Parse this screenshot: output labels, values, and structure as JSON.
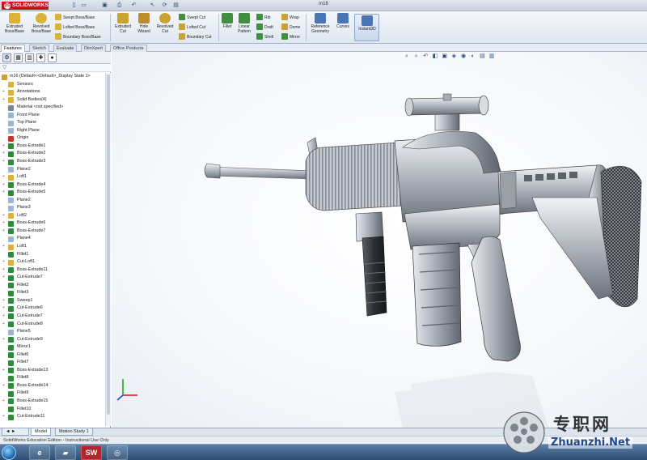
{
  "app": {
    "brand": "SOLIDWORKS",
    "doc_title": "m16",
    "quick_access": [
      "new-icon",
      "open-icon",
      "save-icon",
      "print-icon",
      "undo-icon",
      "select-icon",
      "rebuild-icon",
      "options-icon"
    ]
  },
  "command_manager": {
    "large_tools": [
      {
        "id": "extruded-boss",
        "label": "Extruded Boss/Base",
        "color": "#c9a234"
      },
      {
        "id": "revolved-boss",
        "label": "Revolved Boss/Base",
        "color": "#c9a234"
      },
      {
        "id": "extruded-cut",
        "label": "Extruded Cut",
        "color": "#c9a234"
      },
      {
        "id": "hole-wizard",
        "label": "Hole Wizard",
        "color": "#b88f2c"
      },
      {
        "id": "revolved-cut",
        "label": "Revolved Cut",
        "color": "#c9a234"
      },
      {
        "id": "fillet",
        "label": "Fillet",
        "color": "#3f8f3f"
      },
      {
        "id": "linear-pattern",
        "label": "Linear Pattern",
        "color": "#3f8f3f"
      },
      {
        "id": "reference-geometry",
        "label": "Reference Geometry",
        "color": "#4a74b5"
      },
      {
        "id": "curves",
        "label": "Curves",
        "color": "#4a74b5"
      },
      {
        "id": "instant3d",
        "label": "Instant3D",
        "color": "#4a74b5"
      }
    ],
    "small_tools": [
      {
        "id": "swept-boss",
        "label": "Swept Boss/Base"
      },
      {
        "id": "lofted-boss",
        "label": "Lofted Boss/Base"
      },
      {
        "id": "boundary-boss",
        "label": "Boundary Boss/Base"
      },
      {
        "id": "swept-cut",
        "label": "Swept Cut"
      },
      {
        "id": "lofted-cut",
        "label": "Lofted Cut"
      },
      {
        "id": "boundary-cut",
        "label": "Boundary Cut"
      },
      {
        "id": "rib",
        "label": "Rib"
      },
      {
        "id": "wrap",
        "label": "Wrap"
      },
      {
        "id": "draft",
        "label": "Draft"
      },
      {
        "id": "dome",
        "label": "Dome"
      },
      {
        "id": "shell",
        "label": "Shell"
      },
      {
        "id": "mirror",
        "label": "Mirror"
      }
    ],
    "tabs": [
      "Features",
      "Sketch",
      "Evaluate",
      "DimXpert",
      "Office Products"
    ]
  },
  "feature_tree": {
    "root": "m16  (Default<<Default>_Display State 1>",
    "items": [
      {
        "label": "Sensors",
        "icon": "sensor-icon",
        "exp": ""
      },
      {
        "label": "Annotations",
        "icon": "annotation-icon",
        "exp": "+"
      },
      {
        "label": "Solid Bodies(4)",
        "icon": "solid-bodies-icon",
        "exp": "+"
      },
      {
        "label": "Material <not specified>",
        "icon": "material-icon",
        "exp": ""
      },
      {
        "label": "Front Plane",
        "icon": "plane-icon",
        "exp": ""
      },
      {
        "label": "Top Plane",
        "icon": "plane-icon",
        "exp": ""
      },
      {
        "label": "Right Plane",
        "icon": "plane-icon",
        "exp": ""
      },
      {
        "label": "Origin",
        "icon": "origin-icon",
        "exp": ""
      },
      {
        "label": "Boss-Extrude1",
        "icon": "boss-extrude-icon",
        "exp": "+"
      },
      {
        "label": "Boss-Extrude2",
        "icon": "boss-extrude-icon",
        "exp": "+"
      },
      {
        "label": "Boss-Extrude3",
        "icon": "boss-extrude-icon",
        "exp": "+"
      },
      {
        "label": "Plane2",
        "icon": "plane-icon",
        "exp": ""
      },
      {
        "label": "Loft1",
        "icon": "loft-icon",
        "exp": "+"
      },
      {
        "label": "Boss-Extrude4",
        "icon": "boss-extrude-icon",
        "exp": "+"
      },
      {
        "label": "Boss-Extrude5",
        "icon": "boss-extrude-icon",
        "exp": "+"
      },
      {
        "label": "Plane2",
        "icon": "plane-icon",
        "exp": ""
      },
      {
        "label": "Plane3",
        "icon": "plane-icon",
        "exp": ""
      },
      {
        "label": "Loft2",
        "icon": "loft-icon",
        "exp": "+"
      },
      {
        "label": "Boss-Extrude6",
        "icon": "boss-extrude-icon",
        "exp": "+"
      },
      {
        "label": "Boss-Extrude7",
        "icon": "boss-extrude-icon",
        "exp": "+"
      },
      {
        "label": "Plane4",
        "icon": "plane-icon",
        "exp": ""
      },
      {
        "label": "Loft1",
        "icon": "loft-icon",
        "exp": "+"
      },
      {
        "label": "Fillet1",
        "icon": "fillet-icon",
        "exp": ""
      },
      {
        "label": "Cut-Loft1",
        "icon": "cut-loft-icon",
        "exp": "+"
      },
      {
        "label": "Boss-Extrude11",
        "icon": "boss-extrude-icon",
        "exp": "+"
      },
      {
        "label": "Cut-Extrude7",
        "icon": "cut-extrude-icon",
        "exp": "+"
      },
      {
        "label": "Fillet2",
        "icon": "fillet-icon",
        "exp": ""
      },
      {
        "label": "Fillet3",
        "icon": "fillet-icon",
        "exp": ""
      },
      {
        "label": "Sweep1",
        "icon": "sweep-icon",
        "exp": "+"
      },
      {
        "label": "Cut-Extrude6",
        "icon": "cut-extrude-icon",
        "exp": "+"
      },
      {
        "label": "Cut-Extrude7",
        "icon": "cut-extrude-icon",
        "exp": "+"
      },
      {
        "label": "Cut-Extrude8",
        "icon": "cut-extrude-icon",
        "exp": "+"
      },
      {
        "label": "Plane5",
        "icon": "plane-icon",
        "exp": ""
      },
      {
        "label": "Cut-Extrude9",
        "icon": "cut-extrude-icon",
        "exp": "+"
      },
      {
        "label": "Mirror1",
        "icon": "mirror-icon",
        "exp": ""
      },
      {
        "label": "Fillet6",
        "icon": "fillet-icon",
        "exp": ""
      },
      {
        "label": "Fillet7",
        "icon": "fillet-icon",
        "exp": ""
      },
      {
        "label": "Boss-Extrude13",
        "icon": "boss-extrude-icon",
        "exp": "+"
      },
      {
        "label": "Fillet8",
        "icon": "fillet-icon",
        "exp": ""
      },
      {
        "label": "Boss-Extrude14",
        "icon": "boss-extrude-icon",
        "exp": "+"
      },
      {
        "label": "Fillet9",
        "icon": "fillet-icon",
        "exp": ""
      },
      {
        "label": "Boss-Extrude15",
        "icon": "boss-extrude-icon",
        "exp": "+"
      },
      {
        "label": "Fillet10",
        "icon": "fillet-icon",
        "exp": ""
      },
      {
        "label": "Cut-Extrude11",
        "icon": "cut-extrude-icon",
        "exp": "+"
      }
    ]
  },
  "bottom_tabs": [
    "Model",
    "Motion Study 1"
  ],
  "status": "SolidWorks Education Edition - Instructional Use Only",
  "watermark": {
    "title": "专职网",
    "url": "Zhuanzhi.Net"
  },
  "colors": {
    "accent_red": "#c3151b",
    "icon_yellow": "#d9b23a",
    "tree_icon_green": "#2f8a3e"
  }
}
